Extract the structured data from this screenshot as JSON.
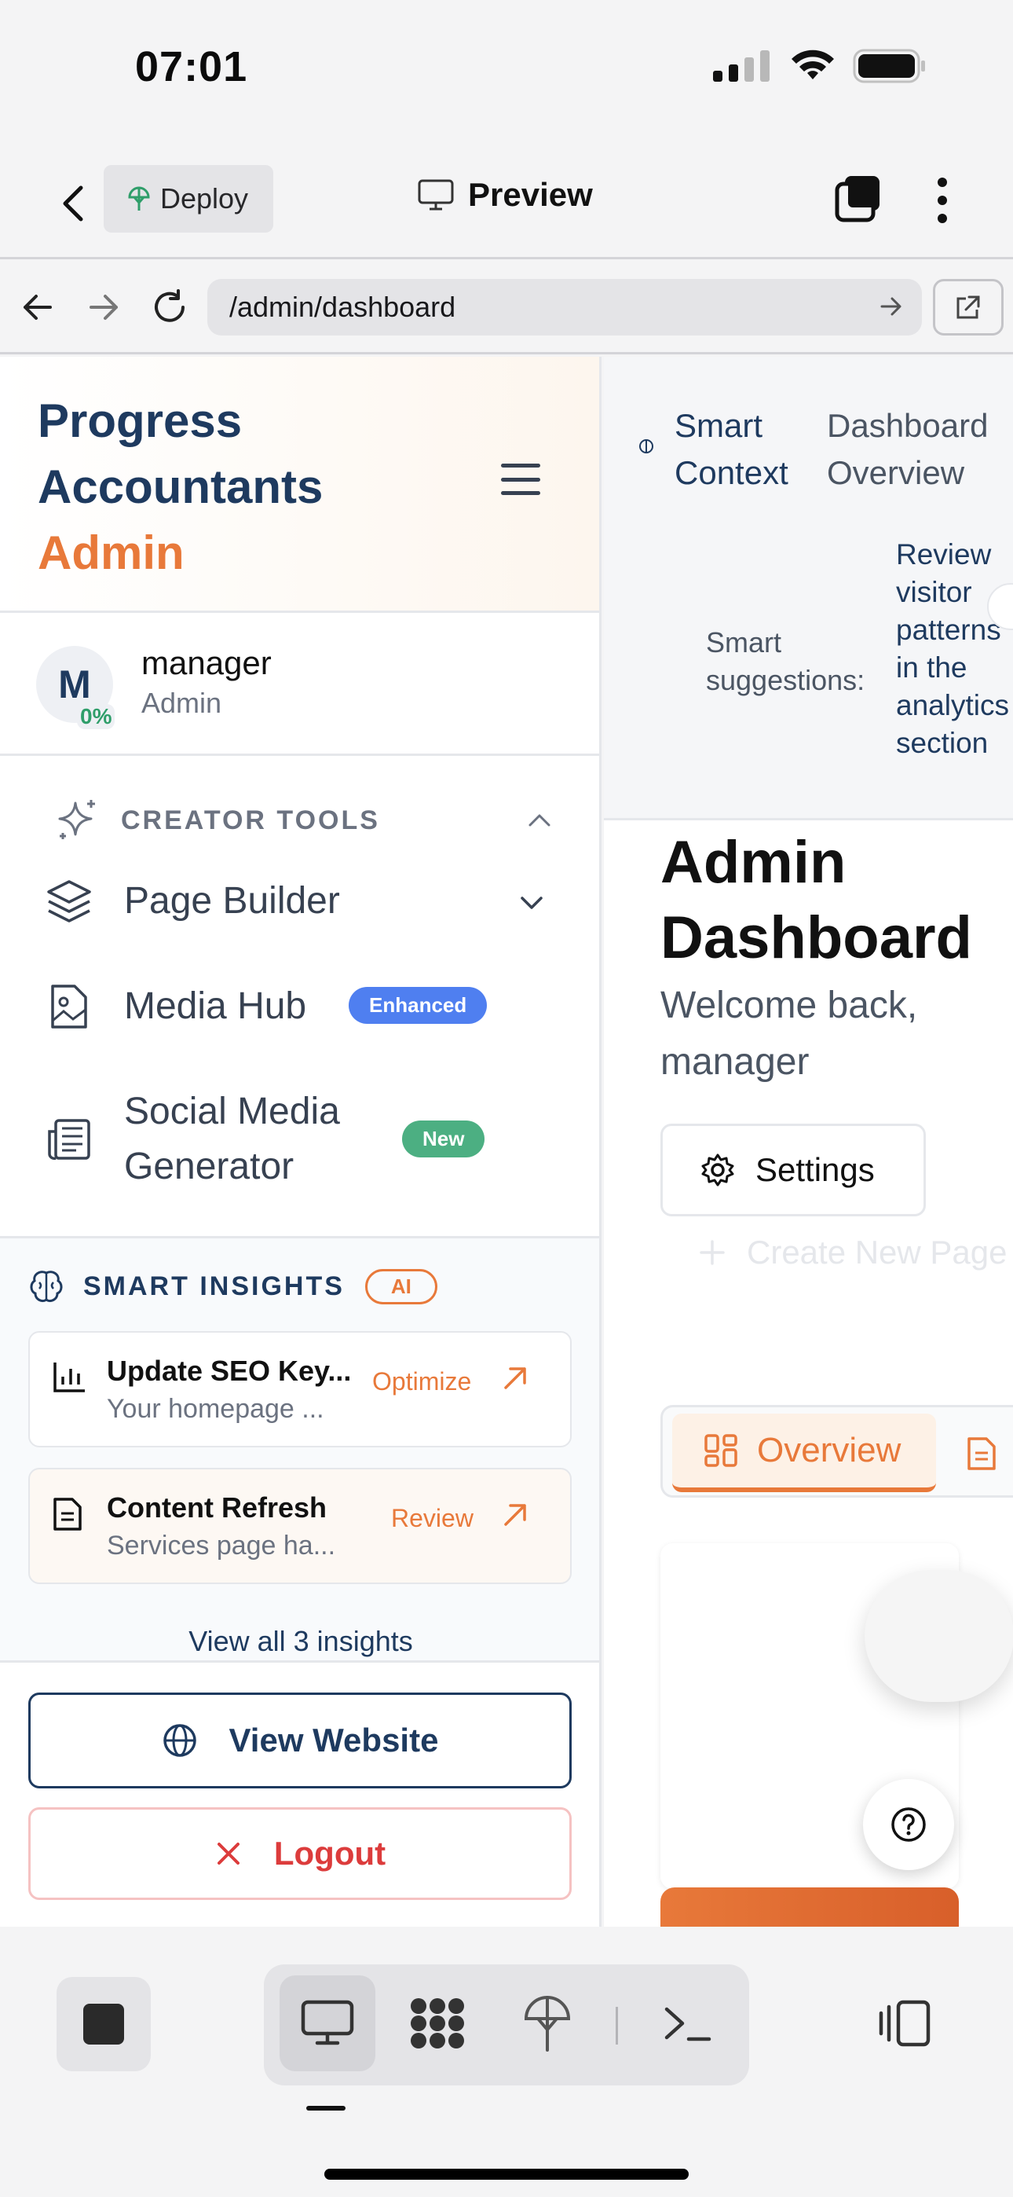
{
  "status": {
    "time": "07:01"
  },
  "header": {
    "deploy_label": "Deploy",
    "preview_label": "Preview"
  },
  "browser": {
    "url": "/admin/dashboard"
  },
  "sidebar": {
    "brand_line1": "Progress",
    "brand_line2": "Accountants",
    "brand_admin": "Admin",
    "user": {
      "initial": "M",
      "progress": "0%",
      "name": "manager",
      "role": "Admin"
    },
    "creator_tools": {
      "heading": "CREATOR TOOLS",
      "items": [
        {
          "label": "Page Builder"
        },
        {
          "label": "Media Hub",
          "badge": "Enhanced"
        },
        {
          "label_line1": "Social Media",
          "label_line2": "Generator",
          "badge": "New"
        }
      ]
    },
    "insights": {
      "heading": "SMART INSIGHTS",
      "ai_badge": "AI",
      "items": [
        {
          "title": "Update SEO Key...",
          "desc": "Your homepage ...",
          "action": "Optimize"
        },
        {
          "title": "Content Refresh",
          "desc": "Services page ha...",
          "action": "Review"
        }
      ],
      "view_all": "View all 3 insights"
    },
    "view_website": "View Website",
    "logout": "Logout"
  },
  "context": {
    "label_line1": "Smart",
    "label_line2": "Context",
    "page_line1": "Dashboard",
    "page_line2": "Overview",
    "suggestions_line1": "Smart",
    "suggestions_line2": "suggestions:",
    "suggestion_lines": [
      "Review",
      "visitor",
      "patterns",
      "in the",
      "analytics",
      "section"
    ]
  },
  "main": {
    "title_line1": "Admin",
    "title_line2": "Dashboard",
    "welcome_line1": "Welcome back,",
    "welcome_line2": "manager",
    "settings_label": "Settings",
    "create_label": "Create New Page",
    "tab_overview": "Overview"
  },
  "colors": {
    "navy": "#1e3a5f",
    "accent": "#e8793a",
    "blue_badge": "#4f7ff0",
    "green_badge": "#4caf82",
    "logout_red": "#dc3c3c"
  }
}
